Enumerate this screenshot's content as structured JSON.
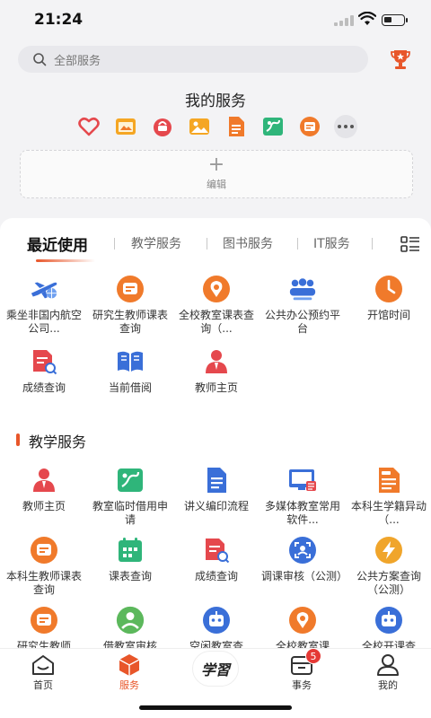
{
  "status_bar": {
    "time": "21:24"
  },
  "search": {
    "placeholder": "全部服务"
  },
  "my_services": {
    "title": "我的服务",
    "icons": [
      "heart-icon",
      "folder-image-icon",
      "bag-icon",
      "photo-icon",
      "document-icon",
      "chart-icon",
      "message-icon",
      "more-icon"
    ],
    "edit_label": "编辑"
  },
  "tabs": [
    "最近使用",
    "教学服务",
    "图书服务",
    "IT服务"
  ],
  "recent": [
    {
      "label": "乘坐非国内航空公司...",
      "icon": "airplane-icon",
      "color": "#3a6fd8"
    },
    {
      "label": "研究生教师课表查询",
      "icon": "message-icon",
      "color": "#f07a2b"
    },
    {
      "label": "全校教室课表查询（...",
      "icon": "location-icon",
      "color": "#f07a2b"
    },
    {
      "label": "公共办公预约平台",
      "icon": "people-icon",
      "color": "#3a6fd8"
    },
    {
      "label": "开馆时间",
      "icon": "clock-icon",
      "color": "#f07a2b"
    },
    {
      "label": "成绩查询",
      "icon": "score-doc-icon",
      "color": "#e5484d"
    },
    {
      "label": "当前借阅",
      "icon": "book-icon",
      "color": "#3a6fd8"
    },
    {
      "label": "教师主页",
      "icon": "teacher-icon",
      "color": "#e5484d"
    }
  ],
  "teaching": {
    "title": "教学服务",
    "items": [
      {
        "label": "教师主页",
        "icon": "teacher-icon",
        "color": "#e5484d"
      },
      {
        "label": "教室临时借用申请",
        "icon": "classroom-icon",
        "color": "#2fb57a"
      },
      {
        "label": "讲义编印流程",
        "icon": "document-icon",
        "color": "#3a6fd8"
      },
      {
        "label": "多媒体教室常用软件...",
        "icon": "monitor-icon",
        "color": "#3a6fd8"
      },
      {
        "label": "本科生学籍异动（...",
        "icon": "student-doc-icon",
        "color": "#f07a2b"
      },
      {
        "label": "本科生教师课表查询",
        "icon": "message-icon",
        "color": "#f07a2b"
      },
      {
        "label": "课表查询",
        "icon": "calendar-icon",
        "color": "#2fb57a"
      },
      {
        "label": "成绩查询",
        "icon": "score-doc-icon",
        "color": "#e5484d"
      },
      {
        "label": "调课审核（公测）",
        "icon": "scan-icon",
        "color": "#3a6fd8"
      },
      {
        "label": "公共方案查询（公测）",
        "icon": "lightning-icon",
        "color": "#f0a52b"
      },
      {
        "label": "研究生教师",
        "icon": "message-icon",
        "color": "#f07a2b"
      },
      {
        "label": "借教室审核",
        "icon": "approve-icon",
        "color": "#5cb85c"
      },
      {
        "label": "空闲教室查",
        "icon": "robot-icon",
        "color": "#3a6fd8"
      },
      {
        "label": "全校教室课",
        "icon": "location-icon",
        "color": "#f07a2b"
      },
      {
        "label": "全校开课查",
        "icon": "robot-icon",
        "color": "#3a6fd8"
      }
    ]
  },
  "tabbar": {
    "items": [
      {
        "label": "首页",
        "icon": "home-icon"
      },
      {
        "label": "服务",
        "icon": "cube-icon"
      },
      {
        "label": "",
        "icon": "xuexi-logo-icon"
      },
      {
        "label": "事务",
        "icon": "tray-icon"
      },
      {
        "label": "我的",
        "icon": "user-icon"
      }
    ],
    "center_logo": "学習",
    "badge": "5"
  },
  "colors": {
    "accent": "#e8562a",
    "blue": "#3a6fd8",
    "green": "#2fb57a",
    "red": "#e5484d"
  }
}
